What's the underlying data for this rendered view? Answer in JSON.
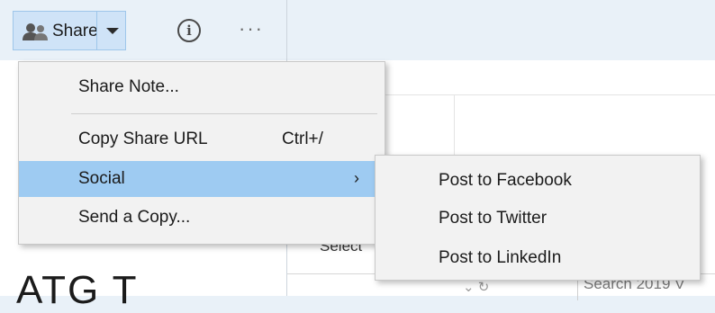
{
  "toolbar": {
    "share_label": "Share",
    "more_glyph": "···",
    "info_glyph": "i"
  },
  "share_menu": {
    "items": [
      {
        "label": "Share Note..."
      },
      {
        "label": "Copy Share URL",
        "shortcut": "Ctrl+/"
      },
      {
        "label": "Social",
        "arrow": "›"
      },
      {
        "label": "Send a Copy..."
      }
    ]
  },
  "social_menu": {
    "items": [
      {
        "label": "Post to Facebook"
      },
      {
        "label": "Post to Twitter"
      },
      {
        "label": "Post to LinkedIn"
      }
    ]
  },
  "note": {
    "big_text": "ATG T"
  },
  "right_panel": {
    "select_text": "Select",
    "bottom_icons": "⌄ ↻",
    "search_text": "Search 2019 V"
  },
  "colors": {
    "highlight": "#9ecbf2",
    "share_button_bg": "#cfe3f7",
    "toolbar_bg": "#e9f1f8"
  },
  "icons": [
    "people-icon",
    "chevron-down-icon",
    "info-icon",
    "more-icon",
    "submenu-arrow-icon"
  ]
}
